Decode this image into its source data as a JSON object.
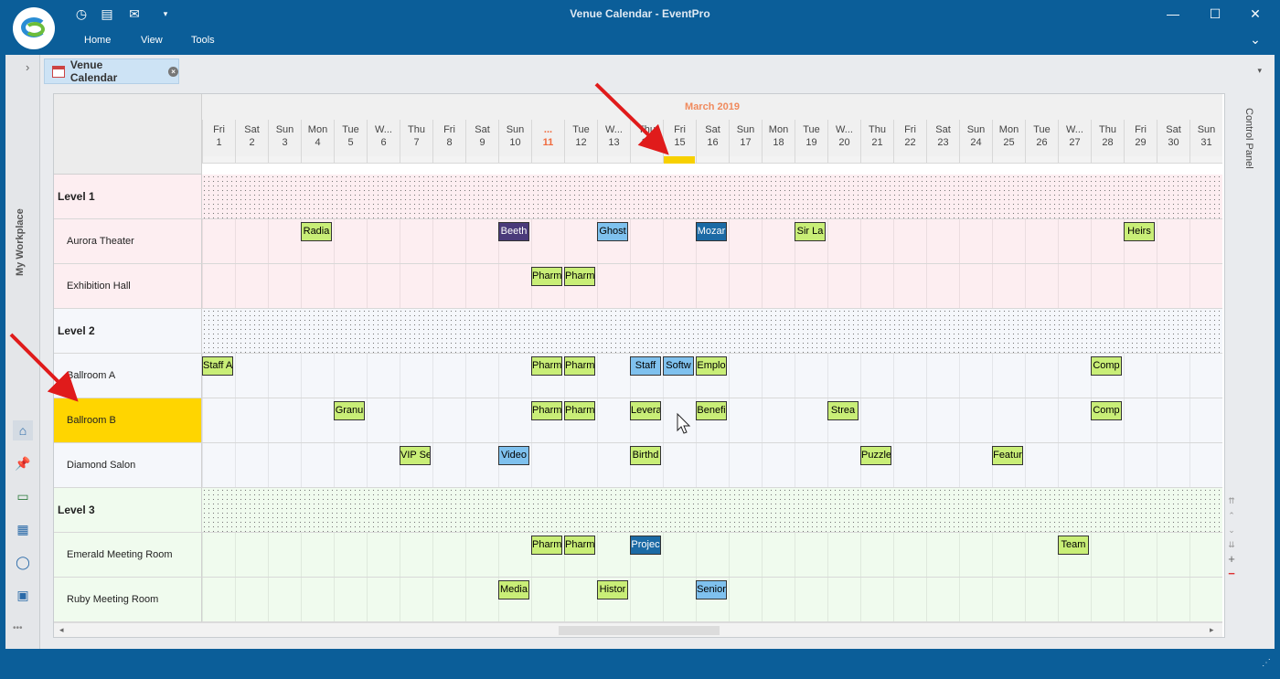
{
  "window": {
    "title": "Venue Calendar - EventPro",
    "menu": [
      "Home",
      "View",
      "Tools"
    ],
    "controls": {
      "minimize": "—",
      "maximize": "☐",
      "close": "✕",
      "ribbon_collapse": "⌄"
    }
  },
  "quick_access": [
    "clock-icon",
    "document-icon",
    "mail-icon",
    "dropdown-icon"
  ],
  "left_nav": {
    "expand": "›",
    "label": "My Workplace",
    "icons": [
      "home-icon",
      "pin-icon",
      "card-icon",
      "contacts-icon",
      "chat-icon",
      "clipboard-icon"
    ],
    "more": "•••"
  },
  "tab": {
    "label": "Venue Calendar",
    "close": "×"
  },
  "control_panel": {
    "label": "Control Panel"
  },
  "calendar": {
    "month": "March 2019",
    "days": [
      {
        "dow": "Fri",
        "day": "1"
      },
      {
        "dow": "Sat",
        "day": "2"
      },
      {
        "dow": "Sun",
        "day": "3"
      },
      {
        "dow": "Mon",
        "day": "4"
      },
      {
        "dow": "Tue",
        "day": "5"
      },
      {
        "dow": "W...",
        "day": "6"
      },
      {
        "dow": "Thu",
        "day": "7"
      },
      {
        "dow": "Fri",
        "day": "8"
      },
      {
        "dow": "Sat",
        "day": "9"
      },
      {
        "dow": "Sun",
        "day": "10"
      },
      {
        "dow": "...",
        "day": "11"
      },
      {
        "dow": "Tue",
        "day": "12"
      },
      {
        "dow": "W...",
        "day": "13"
      },
      {
        "dow": "Thu",
        "day": "14"
      },
      {
        "dow": "Fri",
        "day": "15"
      },
      {
        "dow": "Sat",
        "day": "16"
      },
      {
        "dow": "Sun",
        "day": "17"
      },
      {
        "dow": "Mon",
        "day": "18"
      },
      {
        "dow": "Tue",
        "day": "19"
      },
      {
        "dow": "W...",
        "day": "20"
      },
      {
        "dow": "Thu",
        "day": "21"
      },
      {
        "dow": "Fri",
        "day": "22"
      },
      {
        "dow": "Sat",
        "day": "23"
      },
      {
        "dow": "Sun",
        "day": "24"
      },
      {
        "dow": "Mon",
        "day": "25"
      },
      {
        "dow": "Tue",
        "day": "26"
      },
      {
        "dow": "W...",
        "day": "27"
      },
      {
        "dow": "Thu",
        "day": "28"
      },
      {
        "dow": "Fri",
        "day": "29"
      },
      {
        "dow": "Sat",
        "day": "30"
      },
      {
        "dow": "Sun",
        "day": "31"
      }
    ],
    "today_day": "11",
    "marker_day": "15",
    "rows": [
      {
        "label": "Level 1",
        "group": true,
        "bg": "#fdeef1",
        "appts": []
      },
      {
        "label": "Aurora Theater",
        "group": false,
        "bg": "#fdeef1",
        "appts": [
          {
            "title": "Radia",
            "day": 4,
            "color": "#c9ee77",
            "text": "#000"
          },
          {
            "title": "Beeth",
            "day": 10,
            "color": "#4a3a7a",
            "text": "#fff"
          },
          {
            "title": "Ghost",
            "day": 13,
            "color": "#7fc1ee",
            "text": "#000"
          },
          {
            "title": "Mozar",
            "day": 16,
            "color": "#1b6aa5",
            "text": "#fff"
          },
          {
            "title": "Sir La",
            "day": 19,
            "color": "#c9ee77",
            "text": "#000"
          },
          {
            "title": "Heirs",
            "day": 29,
            "color": "#c9ee77",
            "text": "#000"
          }
        ]
      },
      {
        "label": "Exhibition Hall",
        "group": false,
        "bg": "#fdeef1",
        "appts": [
          {
            "title": "Pharm",
            "day": 11,
            "color": "#c9ee77",
            "text": "#000"
          },
          {
            "title": "Pharm",
            "day": 12,
            "color": "#c9ee77",
            "text": "#000"
          }
        ]
      },
      {
        "label": "Level 2",
        "group": true,
        "bg": "#f5f7fb",
        "appts": []
      },
      {
        "label": "Ballroom A",
        "group": false,
        "bg": "#f5f7fb",
        "appts": [
          {
            "title": "Staff A",
            "day": 1,
            "color": "#c9ee77",
            "text": "#000"
          },
          {
            "title": "Pharm",
            "day": 11,
            "color": "#c9ee77",
            "text": "#000"
          },
          {
            "title": "Pharm",
            "day": 12,
            "color": "#c9ee77",
            "text": "#000"
          },
          {
            "title": "Staff",
            "day": 14,
            "color": "#7fc1ee",
            "text": "#000"
          },
          {
            "title": "Softw",
            "day": 15,
            "color": "#7fc1ee",
            "text": "#000"
          },
          {
            "title": "Emplo",
            "day": 16,
            "color": "#c9ee77",
            "text": "#000"
          },
          {
            "title": "Comp",
            "day": 28,
            "color": "#c9ee77",
            "text": "#000"
          }
        ]
      },
      {
        "label": "Ballroom B",
        "group": false,
        "bg": "#f5f7fb",
        "label_bg": "#ffd500",
        "appts": [
          {
            "title": "Granu",
            "day": 5,
            "color": "#c9ee77",
            "text": "#000"
          },
          {
            "title": "Pharm",
            "day": 11,
            "color": "#c9ee77",
            "text": "#000"
          },
          {
            "title": "Pharm",
            "day": 12,
            "color": "#c9ee77",
            "text": "#000"
          },
          {
            "title": "Levera",
            "day": 14,
            "color": "#c9ee77",
            "text": "#000"
          },
          {
            "title": "Benefi",
            "day": 16,
            "color": "#c9ee77",
            "text": "#000"
          },
          {
            "title": "Strea",
            "day": 20,
            "color": "#c9ee77",
            "text": "#000"
          },
          {
            "title": "Comp",
            "day": 28,
            "color": "#c9ee77",
            "text": "#000"
          }
        ]
      },
      {
        "label": "Diamond Salon",
        "group": false,
        "bg": "#f5f7fb",
        "appts": [
          {
            "title": "VIP Se",
            "day": 7,
            "color": "#c9ee77",
            "text": "#000"
          },
          {
            "title": "Video",
            "day": 10,
            "color": "#7fc1ee",
            "text": "#000"
          },
          {
            "title": "Birthd",
            "day": 14,
            "color": "#c9ee77",
            "text": "#000"
          },
          {
            "title": "Puzzle",
            "day": 21,
            "color": "#c9ee77",
            "text": "#000"
          },
          {
            "title": "Featur",
            "day": 25,
            "color": "#c9ee77",
            "text": "#000"
          }
        ]
      },
      {
        "label": "Level 3",
        "group": true,
        "bg": "#f0fbee",
        "appts": []
      },
      {
        "label": "Emerald Meeting Room",
        "group": false,
        "bg": "#f0fbee",
        "appts": [
          {
            "title": "Pharm",
            "day": 11,
            "color": "#c9ee77",
            "text": "#000"
          },
          {
            "title": "Pharm",
            "day": 12,
            "color": "#c9ee77",
            "text": "#000"
          },
          {
            "title": "Projec",
            "day": 14,
            "color": "#1b6aa5",
            "text": "#fff"
          },
          {
            "title": "Team",
            "day": 27,
            "color": "#c9ee77",
            "text": "#000"
          }
        ]
      },
      {
        "label": "Ruby Meeting Room",
        "group": false,
        "bg": "#f0fbee",
        "appts": [
          {
            "title": "Media",
            "day": 10,
            "color": "#c9ee77",
            "text": "#000"
          },
          {
            "title": "Histor",
            "day": 13,
            "color": "#c9ee77",
            "text": "#000"
          },
          {
            "title": "Senior",
            "day": 16,
            "color": "#7fc1ee",
            "text": "#000"
          }
        ]
      }
    ]
  }
}
